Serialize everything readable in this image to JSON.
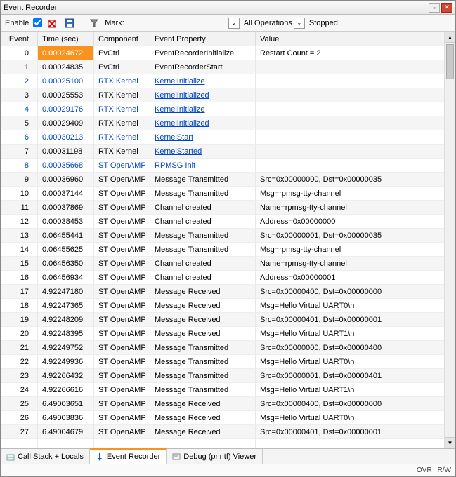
{
  "titlebar": {
    "title": "Event Recorder"
  },
  "toolbar": {
    "enable_label": "Enable",
    "mark_label": "Mark:",
    "ops_label": "All Operations",
    "status_label": "Stopped"
  },
  "columns": [
    "Event",
    "Time (sec)",
    "Component",
    "Event Property",
    "Value"
  ],
  "rows": [
    {
      "event": "0",
      "time": "0.00024672",
      "comp": "EvCtrl",
      "prop": "EventRecorderInitialize",
      "val": "Restart Count = 2",
      "hl": true
    },
    {
      "event": "1",
      "time": "0.00024835",
      "comp": "EvCtrl",
      "prop": "EventRecorderStart",
      "val": ""
    },
    {
      "event": "2",
      "time": "0.00025100",
      "comp": "RTX Kernel",
      "prop": "KernelInitialize",
      "val": "",
      "blue": true,
      "link": true
    },
    {
      "event": "3",
      "time": "0.00025553",
      "comp": "RTX Kernel",
      "prop": "KernelInitialized",
      "val": "",
      "link": true
    },
    {
      "event": "4",
      "time": "0.00029176",
      "comp": "RTX Kernel",
      "prop": "KernelInitialize",
      "val": "",
      "blue": true,
      "link": true
    },
    {
      "event": "5",
      "time": "0.00029409",
      "comp": "RTX Kernel",
      "prop": "KernelInitialized",
      "val": "",
      "link": true
    },
    {
      "event": "6",
      "time": "0.00030213",
      "comp": "RTX Kernel",
      "prop": "KernelStart",
      "val": "",
      "blue": true,
      "link": true
    },
    {
      "event": "7",
      "time": "0.00031198",
      "comp": "RTX Kernel",
      "prop": "KernelStarted",
      "val": "",
      "link": true
    },
    {
      "event": "8",
      "time": "0.00035668",
      "comp": "ST OpenAMP",
      "prop": "RPMSG Init",
      "val": "",
      "blue": true
    },
    {
      "event": "9",
      "time": "0.00036960",
      "comp": "ST OpenAMP",
      "prop": "Message Transmitted",
      "val": "Src=0x00000000, Dst=0x00000035"
    },
    {
      "event": "10",
      "time": "0.00037144",
      "comp": "ST OpenAMP",
      "prop": "Message Transmitted",
      "val": "Msg=rpmsg-tty-channel"
    },
    {
      "event": "11",
      "time": "0.00037869",
      "comp": "ST OpenAMP",
      "prop": "Channel created",
      "val": "Name=rpmsg-tty-channel"
    },
    {
      "event": "12",
      "time": "0.00038453",
      "comp": "ST OpenAMP",
      "prop": "Channel created",
      "val": "Address=0x00000000"
    },
    {
      "event": "13",
      "time": "0.06455441",
      "comp": "ST OpenAMP",
      "prop": "Message Transmitted",
      "val": "Src=0x00000001, Dst=0x00000035"
    },
    {
      "event": "14",
      "time": "0.06455625",
      "comp": "ST OpenAMP",
      "prop": "Message Transmitted",
      "val": "Msg=rpmsg-tty-channel"
    },
    {
      "event": "15",
      "time": "0.06456350",
      "comp": "ST OpenAMP",
      "prop": "Channel created",
      "val": "Name=rpmsg-tty-channel"
    },
    {
      "event": "16",
      "time": "0.06456934",
      "comp": "ST OpenAMP",
      "prop": "Channel created",
      "val": "Address=0x00000001"
    },
    {
      "event": "17",
      "time": "4.92247180",
      "comp": "ST OpenAMP",
      "prop": "Message Received",
      "val": "Src=0x00000400, Dst=0x00000000"
    },
    {
      "event": "18",
      "time": "4.92247365",
      "comp": "ST OpenAMP",
      "prop": "Message Received",
      "val": "Msg=Hello Virtual UART0\\n"
    },
    {
      "event": "19",
      "time": "4.92248209",
      "comp": "ST OpenAMP",
      "prop": "Message Received",
      "val": "Src=0x00000401, Dst=0x00000001"
    },
    {
      "event": "20",
      "time": "4.92248395",
      "comp": "ST OpenAMP",
      "prop": "Message Received",
      "val": "Msg=Hello Virtual UART1\\n"
    },
    {
      "event": "21",
      "time": "4.92249752",
      "comp": "ST OpenAMP",
      "prop": "Message Transmitted",
      "val": "Src=0x00000000, Dst=0x00000400"
    },
    {
      "event": "22",
      "time": "4.92249936",
      "comp": "ST OpenAMP",
      "prop": "Message Transmitted",
      "val": "Msg=Hello Virtual UART0\\n"
    },
    {
      "event": "23",
      "time": "4.92266432",
      "comp": "ST OpenAMP",
      "prop": "Message Transmitted",
      "val": "Src=0x00000001, Dst=0x00000401"
    },
    {
      "event": "24",
      "time": "4.92266616",
      "comp": "ST OpenAMP",
      "prop": "Message Transmitted",
      "val": "Msg=Hello Virtual UART1\\n"
    },
    {
      "event": "25",
      "time": "6.49003651",
      "comp": "ST OpenAMP",
      "prop": "Message Received",
      "val": "Src=0x00000400, Dst=0x00000000"
    },
    {
      "event": "26",
      "time": "6.49003836",
      "comp": "ST OpenAMP",
      "prop": "Message Received",
      "val": "Msg=Hello Virtual UART0\\n"
    },
    {
      "event": "27",
      "time": "6.49004679",
      "comp": "ST OpenAMP",
      "prop": "Message Received",
      "val": "Src=0x00000401, Dst=0x00000001"
    }
  ],
  "tabs": [
    {
      "label": "Call Stack + Locals",
      "active": false
    },
    {
      "label": "Event Recorder",
      "active": true
    },
    {
      "label": "Debug (printf) Viewer",
      "active": false
    }
  ],
  "status": {
    "ovr": "OVR",
    "rw": "R/W"
  }
}
